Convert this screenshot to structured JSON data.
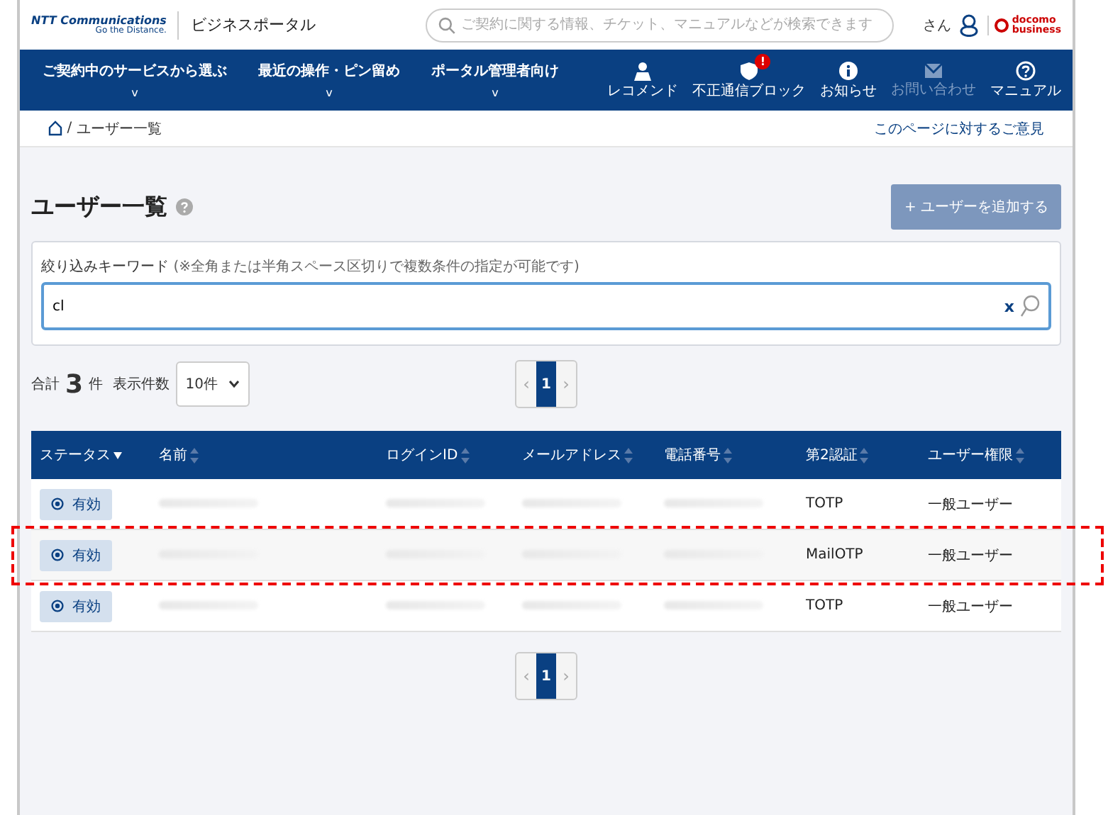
{
  "header": {
    "logo_text": "NTT Communications",
    "logo_tagline": "Go the Distance.",
    "portal_title": "ビジネスポータル",
    "search": {
      "placeholder": "ご契約に関する情報、チケット、マニュアルなどが検索できます"
    },
    "user_suffix": "さん",
    "brand_top": "docomo",
    "brand_bottom": "business"
  },
  "nav": {
    "menus": [
      {
        "label": "ご契約中のサービスから選ぶ",
        "caret": "v"
      },
      {
        "label": "最近の操作・ピン留め",
        "caret": "v"
      },
      {
        "label": "ポータル管理者向け",
        "caret": "v"
      }
    ],
    "icons": [
      {
        "kind": "person",
        "label": "レコメンド",
        "disabled": false
      },
      {
        "kind": "shield",
        "label": "不正通信ブロック",
        "badge": "!",
        "disabled": false
      },
      {
        "kind": "info",
        "label": "お知らせ",
        "disabled": false
      },
      {
        "kind": "mail",
        "label": "お問い合わせ",
        "disabled": true
      },
      {
        "kind": "help",
        "label": "マニュアル",
        "disabled": false
      }
    ]
  },
  "breadcrumb": {
    "separator": "/",
    "current": "ユーザー一覧",
    "feedback_link": "このページに対するご意見"
  },
  "page": {
    "title": "ユーザー一覧",
    "add_button": {
      "label": "+ ユーザーを追加する",
      "disabled": true
    }
  },
  "filter": {
    "label": "絞り込みキーワード",
    "note": "(※全角または半角スペース区切りで複数条件の指定が可能です)",
    "value": "cl",
    "clear": "x"
  },
  "summary": {
    "total_label": "合計",
    "total": "3",
    "total_unit": "件",
    "per_page_label": "表示件数",
    "per_page": "10件"
  },
  "pagination_top": {
    "prev": "‹",
    "next": "›",
    "pages": [
      {
        "label": "1",
        "selected": true
      }
    ]
  },
  "table": {
    "columns": [
      {
        "label": "ステータス",
        "sorted": true
      },
      {
        "label": "名前",
        "sorted": false
      },
      {
        "label": "ログインID",
        "sorted": false
      },
      {
        "label": "メールアドレス",
        "sorted": false
      },
      {
        "label": "電話番号",
        "sorted": false
      },
      {
        "label": "第2認証",
        "sorted": false
      },
      {
        "label": "ユーザー権限",
        "sorted": false
      }
    ],
    "rows": [
      {
        "highlighted": false,
        "cells": [
          {
            "kind": "status",
            "text": "有効"
          },
          {
            "kind": "redacted"
          },
          {
            "kind": "redacted"
          },
          {
            "kind": "redacted"
          },
          {
            "kind": "redacted"
          },
          {
            "kind": "text",
            "text": "TOTP"
          },
          {
            "kind": "text",
            "text": "一般ユーザー"
          }
        ]
      },
      {
        "highlighted": true,
        "cells": [
          {
            "kind": "status",
            "text": "有効"
          },
          {
            "kind": "redacted"
          },
          {
            "kind": "redacted"
          },
          {
            "kind": "redacted"
          },
          {
            "kind": "redacted"
          },
          {
            "kind": "text",
            "text": "MailOTP"
          },
          {
            "kind": "text",
            "text": "一般ユーザー"
          }
        ]
      },
      {
        "highlighted": false,
        "cells": [
          {
            "kind": "status",
            "text": "有効"
          },
          {
            "kind": "redacted"
          },
          {
            "kind": "redacted"
          },
          {
            "kind": "redacted"
          },
          {
            "kind": "redacted"
          },
          {
            "kind": "text",
            "text": "TOTP"
          },
          {
            "kind": "text",
            "text": "一般ユーザー"
          }
        ]
      }
    ]
  },
  "pagination_bottom": {
    "prev": "‹",
    "next": "›",
    "pages": [
      {
        "label": "1",
        "selected": true
      }
    ]
  }
}
